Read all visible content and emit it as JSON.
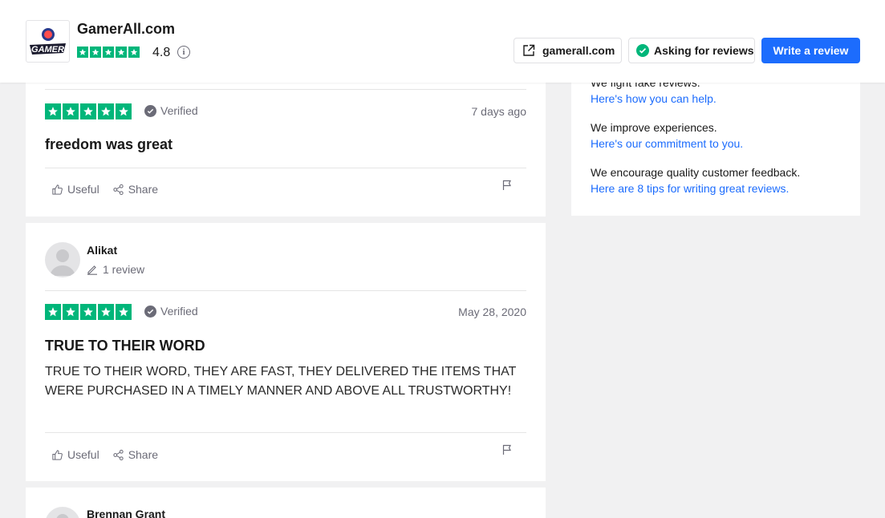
{
  "header": {
    "company_name": "GamerAll.com",
    "logo_text": "GAMER",
    "rating": "4.8",
    "info_symbol": "i",
    "site_label": "gamerall.com",
    "asking_label": "Asking for reviews",
    "write_label": "Write a review"
  },
  "sidebar": {
    "line1_text": "We fight fake reviews.",
    "line1_link": "Here's how you can help.",
    "line2_text": "We improve experiences.",
    "line2_link": "Here's our commitment to you.",
    "line3_text": "We encourage quality customer feedback.",
    "line3_link": "Here are 8 tips for writing great reviews."
  },
  "reviews": [
    {
      "stars": 5,
      "verified_label": "Verified",
      "date": "7 days ago",
      "title": "freedom was great",
      "useful_label": "Useful",
      "share_label": "Share"
    },
    {
      "reviewer": "Alikat",
      "review_count": "1 review",
      "stars": 5,
      "verified_label": "Verified",
      "date": "May 28, 2020",
      "title": "TRUE TO THEIR WORD",
      "body": "TRUE TO THEIR WORD, THEY ARE FAST, THEY DELIVERED THE ITEMS THAT WERE PURCHASED IN A TIMELY MANNER AND ABOVE ALL TRUSTWORTHY!",
      "useful_label": "Useful",
      "share_label": "Share"
    },
    {
      "reviewer": "Brennan Grant"
    }
  ],
  "colors": {
    "star_green": "#00b67a",
    "link_blue": "#1c6cfd",
    "muted_gray": "#6b6b77"
  }
}
